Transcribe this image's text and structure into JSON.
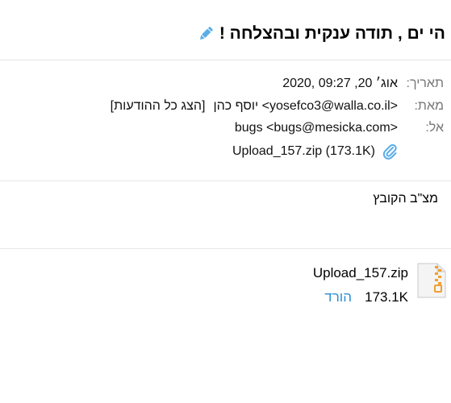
{
  "subject": "הי ים , תודה ענקית ובהצלחה !",
  "meta": {
    "date_label": "תאריך:",
    "date_value": "2020, אוג׳ 20, 09:27",
    "from_label": "מאת:",
    "from_name": "יוסף כהן <yosefco3@walla.co.il>",
    "show_all_messages": "[הצג כל ההודעות]",
    "to_label": "אל:",
    "to_value": "bugs <bugs@mesicka.com>",
    "attachment_summary": "Upload_157.zip (173.1K)"
  },
  "body": {
    "text": "מצ\"ב הקובץ"
  },
  "attachment": {
    "icon": "zip-file-icon",
    "filename": "Upload_157.zip",
    "size": "173.1K",
    "download_label": "הורד"
  },
  "colors": {
    "link": "#2a8fd4",
    "label": "#777777",
    "divider": "#e6e6e6",
    "zip_accent": "#f0a030"
  }
}
